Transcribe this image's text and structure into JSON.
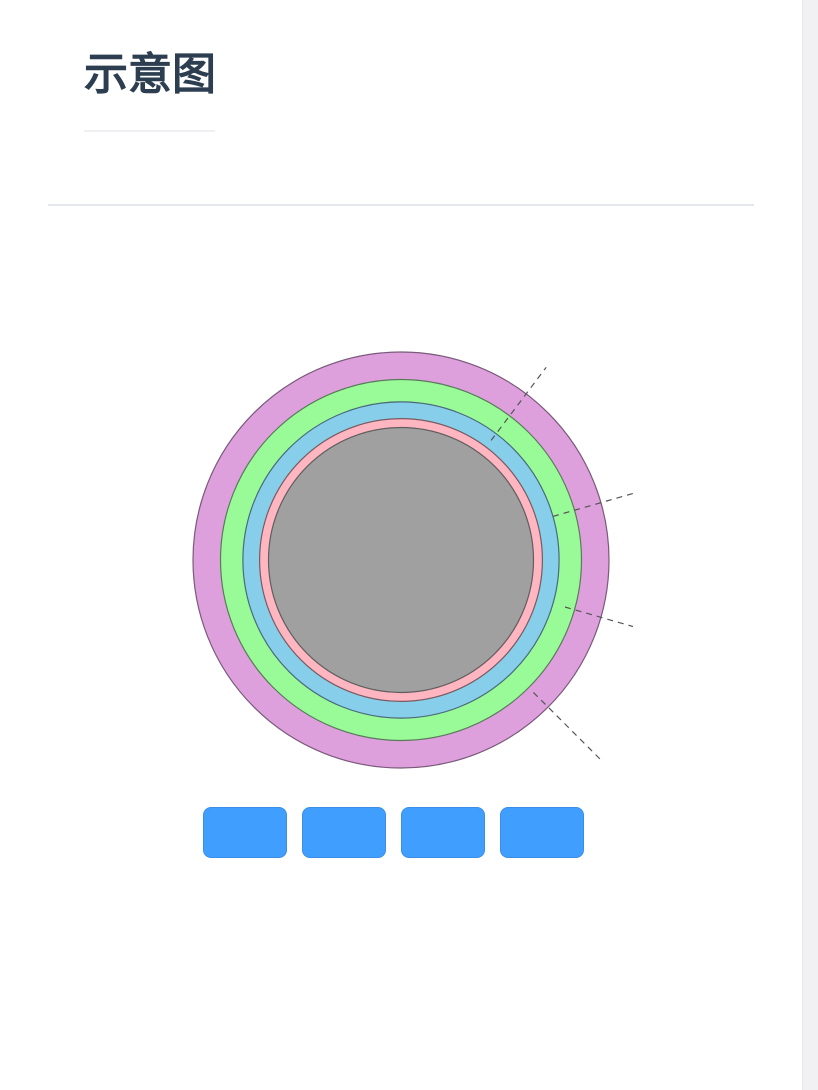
{
  "page": {
    "title": "示意图"
  },
  "diagram": {
    "rings": [
      {
        "name": "outer-layer",
        "color": "#dda0dd",
        "stroke": "#7a5a7a",
        "radius_fraction": 1.0
      },
      {
        "name": "second-layer",
        "color": "#98fb98",
        "stroke": "#5a7a5a",
        "radius_fraction": 0.868
      },
      {
        "name": "third-layer",
        "color": "#87ceeb",
        "stroke": "#4a6a7a",
        "radius_fraction": 0.76
      },
      {
        "name": "fourth-layer",
        "color": "#ffb6c1",
        "stroke": "#7a5a5e",
        "radius_fraction": 0.68
      },
      {
        "name": "core",
        "color": "#a0a0a0",
        "stroke": "#5f5f5f",
        "radius_fraction": 0.637
      }
    ],
    "leader_lines": [
      {
        "name": "leader-line-1",
        "angle_deg": -53
      },
      {
        "name": "leader-line-2",
        "angle_deg": -16
      },
      {
        "name": "leader-line-3",
        "angle_deg": 16
      },
      {
        "name": "leader-line-4",
        "angle_deg": 45
      }
    ]
  },
  "buttons": [
    {
      "label": ""
    },
    {
      "label": ""
    },
    {
      "label": ""
    },
    {
      "label": ""
    }
  ],
  "colors": {
    "accent": "#409eff",
    "title": "#2c3e50"
  }
}
